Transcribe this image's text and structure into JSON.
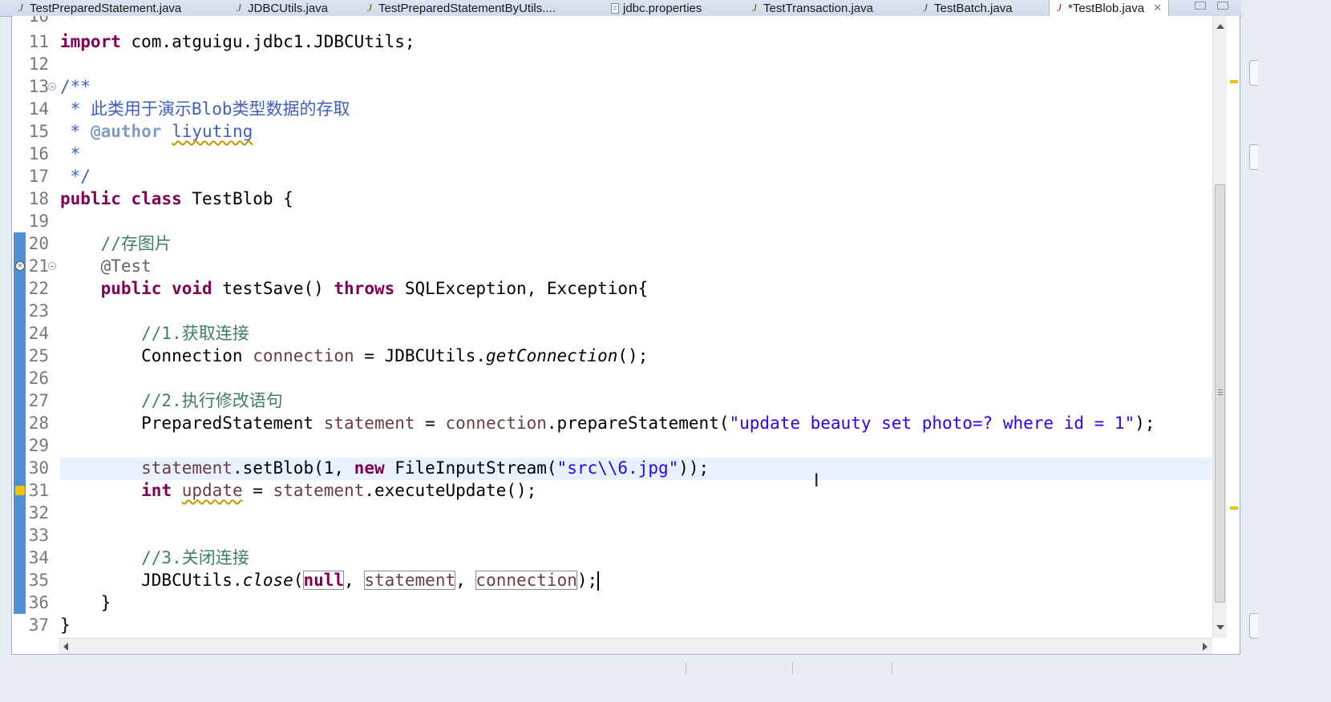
{
  "tabs": [
    {
      "label": "TestPreparedStatement.java",
      "icon": "java-file-icon",
      "active": false
    },
    {
      "label": "JDBCUtils.java",
      "icon": "java-file-icon",
      "active": false
    },
    {
      "label": "TestPreparedStatementByUtils....",
      "icon": "java-file-icon",
      "active": false
    },
    {
      "label": "jdbc.properties",
      "icon": "properties-file-icon",
      "active": false
    },
    {
      "label": "TestTransaction.java",
      "icon": "java-file-icon",
      "active": false
    },
    {
      "label": "TestBatch.java",
      "icon": "java-file-icon",
      "active": false
    },
    {
      "label": "*TestBlob.java",
      "icon": "java-file-icon",
      "active": true,
      "close": "✕"
    }
  ],
  "editor": {
    "partial_line_number": "10",
    "lines": [
      {
        "n": "11",
        "code": "import com.atguigu.jdbc1.JDBCUtils;"
      },
      {
        "n": "12",
        "code": ""
      },
      {
        "n": "13",
        "code": "/**"
      },
      {
        "n": "14",
        "code": " * 此类用于演示Blob类型数据的存取"
      },
      {
        "n": "15",
        "code": " * @author liyuting"
      },
      {
        "n": "16",
        "code": " *"
      },
      {
        "n": "17",
        "code": " */"
      },
      {
        "n": "18",
        "code": "public class TestBlob {"
      },
      {
        "n": "19",
        "code": ""
      },
      {
        "n": "20",
        "code": "    //存图片"
      },
      {
        "n": "21",
        "code": "    @Test"
      },
      {
        "n": "22",
        "code": "    public void testSave() throws SQLException, Exception{"
      },
      {
        "n": "23",
        "code": ""
      },
      {
        "n": "24",
        "code": "        //1.获取连接"
      },
      {
        "n": "25",
        "code": "        Connection connection = JDBCUtils.getConnection();"
      },
      {
        "n": "26",
        "code": ""
      },
      {
        "n": "27",
        "code": "        //2.执行修改语句"
      },
      {
        "n": "28",
        "code": "        PreparedStatement statement = connection.prepareStatement(\"update beauty set photo=? where id = 1\");"
      },
      {
        "n": "29",
        "code": ""
      },
      {
        "n": "30",
        "code": "        statement.setBlob(1, new FileInputStream(\"src\\\\6.jpg\"));"
      },
      {
        "n": "31",
        "code": "        int update = statement.executeUpdate();"
      },
      {
        "n": "32",
        "code": ""
      },
      {
        "n": "33",
        "code": ""
      },
      {
        "n": "34",
        "code": "        //3.关闭连接"
      },
      {
        "n": "35",
        "code": "        JDBCUtils.close(null, statement, connection);"
      },
      {
        "n": "36",
        "code": "    }"
      },
      {
        "n": "37",
        "code": "}"
      }
    ],
    "current_line": "30",
    "cursor_line": "35"
  },
  "colors": {
    "keyword": "#7f0055",
    "comment": "#3f7f5f",
    "javadoc": "#3f5fbf",
    "string": "#2a00ff",
    "local_variable": "#6a3e3e",
    "change_bar": "#4f8fd6",
    "current_line_bg": "#e8f2fe",
    "warning": "#f2c200"
  }
}
